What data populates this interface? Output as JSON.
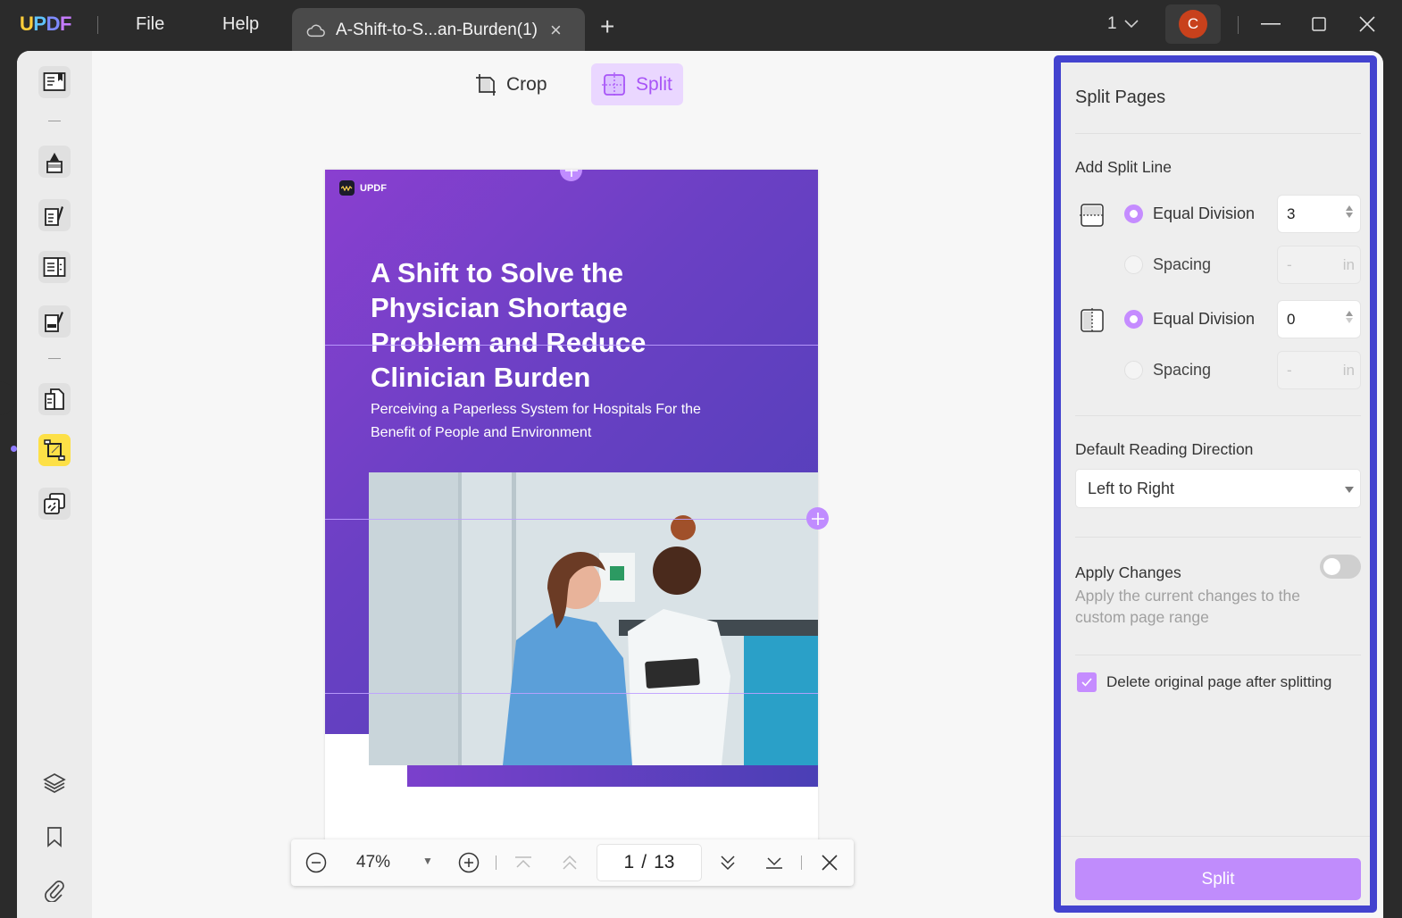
{
  "app": {
    "logo_letters": [
      "U",
      "P",
      "D",
      "F"
    ],
    "menu": {
      "file": "File",
      "help": "Help"
    },
    "tab": {
      "title": "A-Shift-to-S...an-Burden(1)",
      "close": "×",
      "new_tab": "+"
    },
    "window_count": "1",
    "user_initial": "C",
    "colors": {
      "accent": "#C08CFC",
      "panel_frame": "#4343CF",
      "active_tool": "#FDE047",
      "avatar": "#C8411C"
    }
  },
  "sidebar": {
    "items": [
      {
        "name": "reader",
        "icon": "book-icon",
        "active": false
      },
      {
        "name": "comment",
        "icon": "highlighter-icon",
        "active": false
      },
      {
        "name": "edit",
        "icon": "edit-text-icon",
        "active": false
      },
      {
        "name": "form",
        "icon": "form-icon",
        "active": false
      },
      {
        "name": "fill-sign",
        "icon": "sign-icon",
        "active": false
      },
      {
        "name": "organize",
        "icon": "pages-icon",
        "active": false
      },
      {
        "name": "crop",
        "icon": "crop-icon",
        "active": true
      },
      {
        "name": "convert",
        "icon": "convert-icon",
        "active": false
      }
    ],
    "bottom": [
      {
        "name": "layers",
        "icon": "layers-icon"
      },
      {
        "name": "bookmark",
        "icon": "bookmark-icon"
      },
      {
        "name": "attachment",
        "icon": "paperclip-icon"
      }
    ]
  },
  "toolbar": {
    "crop_label": "Crop",
    "split_label": "Split",
    "active": "Split"
  },
  "page": {
    "brand": "UPDF",
    "title": "A Shift to Solve the Physician Shortage Problem and Reduce Clinician Burden",
    "subtitle": "Perceiving a Paperless System for Hospitals For the Benefit of People and Environment",
    "image_alt": "Two clinicians looking at a tablet in a hospital room",
    "horizontal_split_count": 3
  },
  "navbar": {
    "zoom": "47%",
    "current_page": "1",
    "separator": "/",
    "total_pages": "13"
  },
  "panel": {
    "title": "Split Pages",
    "add_split_line": "Add Split Line",
    "horizontal": {
      "equal_division_label": "Equal Division",
      "equal_division_value": "3",
      "spacing_label": "Spacing",
      "spacing_value": "-",
      "unit": "in",
      "selected": "Equal Division"
    },
    "vertical": {
      "equal_division_label": "Equal Division",
      "equal_division_value": "0",
      "spacing_label": "Spacing",
      "spacing_value": "-",
      "unit": "in",
      "selected": "Equal Division"
    },
    "reading_direction_label": "Default Reading Direction",
    "reading_direction_value": "Left to Right",
    "apply_changes_label": "Apply Changes",
    "apply_changes_on": false,
    "apply_changes_desc": "Apply the current changes to the custom page range",
    "delete_original_label": "Delete original page after splitting",
    "delete_original_checked": true,
    "split_button": "Split"
  }
}
